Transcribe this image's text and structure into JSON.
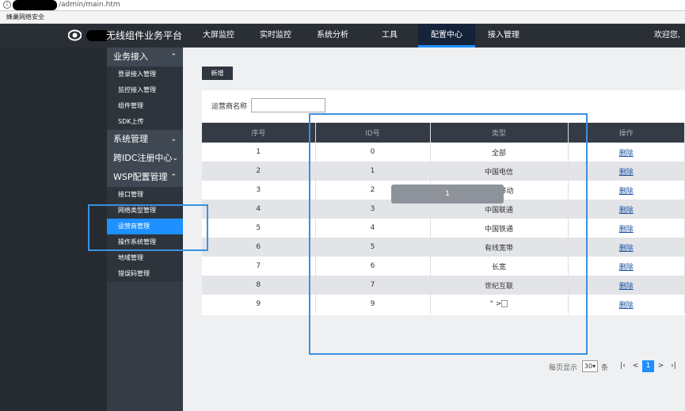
{
  "browser": {
    "url_suffix": "/admin/main.htm",
    "bookmark": "蜂巢网络安全"
  },
  "header": {
    "brand": "无线组件业务平台",
    "nav": [
      "大屏监控",
      "实时监控",
      "系统分析",
      "工具",
      "配置中心",
      "接入管理"
    ],
    "welcome": "欢迎您,"
  },
  "sidebar": {
    "groups": [
      {
        "label": "业务接入",
        "chevron": "^",
        "items": [
          "登录接入管理",
          "监控接入管理",
          "组件管理",
          "SDK上传"
        ]
      },
      {
        "label": "系统管理",
        "chevron": "v",
        "items": []
      },
      {
        "label": "跨IDC注册中心",
        "chevron": "v",
        "items": []
      },
      {
        "label": "WSP配置管理",
        "chevron": "^",
        "items": [
          "接口管理",
          "网络类型管理",
          "运营商管理",
          "操作系统管理",
          "地域管理",
          "错误码管理"
        ]
      }
    ],
    "active_item": "运营商管理"
  },
  "main": {
    "new_button": "新增",
    "filter_label": "运营商名称",
    "filter_value": "",
    "columns": [
      "序号",
      "ID号",
      "类型",
      "操作"
    ],
    "rows": [
      [
        "1",
        "0",
        "全部",
        "删除"
      ],
      [
        "2",
        "1",
        "中国电信",
        "删除"
      ],
      [
        "3",
        "2",
        "移动",
        "删除"
      ],
      [
        "4",
        "3",
        "中国联通",
        "删除"
      ],
      [
        "5",
        "4",
        "中国铁通",
        "删除"
      ],
      [
        "6",
        "5",
        "有线宽带",
        "删除"
      ],
      [
        "7",
        "6",
        "长宽",
        "删除"
      ],
      [
        "8",
        "7",
        "世纪互联",
        "删除"
      ],
      [
        "9",
        "9",
        "\" >",
        "删除"
      ]
    ],
    "pager": {
      "per_page_label": "每页显示",
      "per_page": "30",
      "unit": "条",
      "current_page": "1",
      "first": "K",
      "prev": "<",
      "next": ">",
      "last": "K"
    },
    "tooltip": "1"
  },
  "colors": {
    "accent": "#1e90ff",
    "header_bg": "#2a2f36",
    "sidebar_bg": "#353c45",
    "highlight_box": "#3a90e0"
  }
}
